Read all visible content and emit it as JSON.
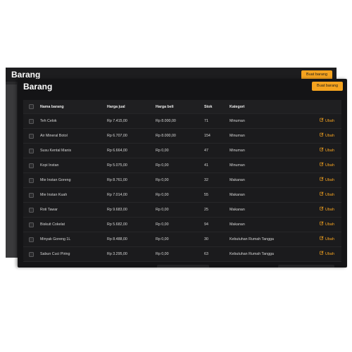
{
  "back_window": {
    "title": "Barang",
    "add_button_label": "Buat barang"
  },
  "front_window": {
    "title": "Barang",
    "add_button_label": "Buat barang"
  },
  "table": {
    "headers": {
      "name": "Nama barang",
      "sell_price": "Harga jual",
      "buy_price": "Harga beli",
      "stock": "Stok",
      "category": "Kategori"
    },
    "edit_label": "Ubah",
    "rows": [
      {
        "name": "Teh Celok",
        "sell_price": "Rp 7.415,00",
        "buy_price": "Rp 8.000,00",
        "stock": "71",
        "category": "Minuman"
      },
      {
        "name": "Air Mineral Botol",
        "sell_price": "Rp 6.707,00",
        "buy_price": "Rp 8.000,00",
        "stock": "154",
        "category": "Minuman"
      },
      {
        "name": "Susu Kental Manis",
        "sell_price": "Rp 6.664,00",
        "buy_price": "Rp 0,00",
        "stock": "47",
        "category": "Minuman"
      },
      {
        "name": "Kopi Instan",
        "sell_price": "Rp 5.075,00",
        "buy_price": "Rp 0,00",
        "stock": "41",
        "category": "Minuman"
      },
      {
        "name": "Mie Instan Goreng",
        "sell_price": "Rp 8.761,00",
        "buy_price": "Rp 0,00",
        "stock": "32",
        "category": "Makanan"
      },
      {
        "name": "Mie Instan Kuah",
        "sell_price": "Rp 7.014,00",
        "buy_price": "Rp 0,00",
        "stock": "55",
        "category": "Makanan"
      },
      {
        "name": "Roti Tawar",
        "sell_price": "Rp 9.683,00",
        "buy_price": "Rp 0,00",
        "stock": "25",
        "category": "Makanan"
      },
      {
        "name": "Biskuit Cokelat",
        "sell_price": "Rp 5.682,00",
        "buy_price": "Rp 0,00",
        "stock": "94",
        "category": "Makanan"
      },
      {
        "name": "Minyak Goreng 1L",
        "sell_price": "Rp 8.488,00",
        "buy_price": "Rp 0,00",
        "stock": "30",
        "category": "Kebutuhan Rumah Tangga"
      },
      {
        "name": "Sabun Cuci Piring",
        "sell_price": "Rp 3.295,00",
        "buy_price": "Rp 0,00",
        "stock": "63",
        "category": "Kebutuhan Rumah Tangga"
      }
    ]
  },
  "icons": {
    "edit": "pencil-square-icon",
    "checkbox": "checkbox-empty"
  },
  "colors": {
    "accent": "#f5a31f",
    "background": "#141416"
  }
}
